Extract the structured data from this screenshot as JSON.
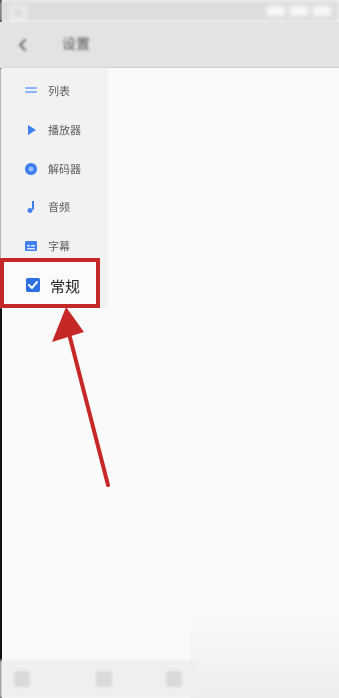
{
  "window": {
    "title": "设置"
  },
  "menu": {
    "items": [
      {
        "label": "列表",
        "icon": "list-icon"
      },
      {
        "label": "播放器",
        "icon": "play-icon"
      },
      {
        "label": "解码器",
        "icon": "decoder-icon"
      },
      {
        "label": "音频",
        "icon": "music-icon"
      },
      {
        "label": "字幕",
        "icon": "subtitle-icon"
      }
    ],
    "selected": {
      "label": "常规",
      "icon": "checkbox-icon"
    }
  },
  "colors": {
    "accent": "#2f6fe4",
    "highlight": "#c62828"
  }
}
